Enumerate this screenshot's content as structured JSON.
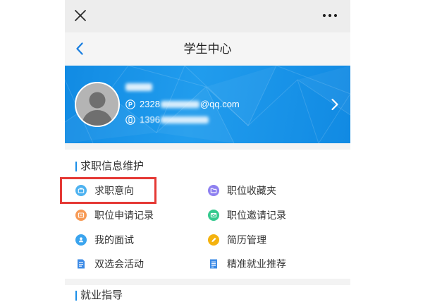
{
  "window": {
    "close_icon": "close-icon",
    "more_icon": "more-icon"
  },
  "nav": {
    "back_icon": "chevron-left-icon",
    "title": "学生中心",
    "accent": "#1a7fe0"
  },
  "profile": {
    "avatar_icon": "user-silhouette-icon",
    "email_icon": "email-icon",
    "email_prefix": "2328",
    "email_suffix": "@qq.com",
    "phone_icon": "phone-icon",
    "phone_prefix": "1396",
    "arrow_icon": "chevron-right-icon",
    "banner_color": "#1396ec"
  },
  "sections": [
    {
      "title": "求职信息维护",
      "bar_color": "#1a8fe8",
      "items": [
        {
          "label": "求职意向",
          "icon": "briefcase-icon",
          "color": "#4db2f0",
          "highlighted": true
        },
        {
          "label": "职位收藏夹",
          "icon": "folder-icon",
          "color": "#8e80f0"
        },
        {
          "label": "职位申请记录",
          "icon": "card-icon",
          "color": "#f79a55"
        },
        {
          "label": "职位邀请记录",
          "icon": "envelope-icon",
          "color": "#34c98e"
        },
        {
          "label": "我的面试",
          "icon": "person-icon",
          "color": "#3aa4ee"
        },
        {
          "label": "简历管理",
          "icon": "pen-icon",
          "color": "#f4b20e"
        },
        {
          "label": "双选会活动",
          "icon": "document-icon",
          "color": "#3d8be6"
        },
        {
          "label": "精准就业推荐",
          "icon": "document-icon",
          "color": "#3d8be6"
        }
      ]
    },
    {
      "title": "就业指导",
      "bar_color": "#1a8fe8"
    }
  ],
  "highlight": {
    "color": "#e53935"
  }
}
